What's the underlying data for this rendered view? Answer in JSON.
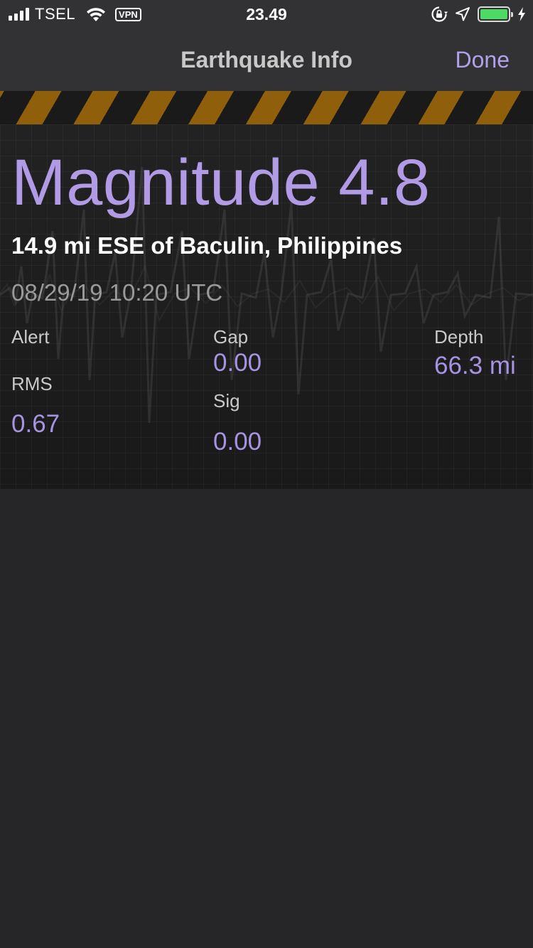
{
  "status_bar": {
    "carrier": "TSEL",
    "vpn_label": "VPN",
    "time": "23.49",
    "battery_level": 1.0,
    "icons": [
      "signal-icon",
      "wifi-icon",
      "vpn-badge",
      "rotation-lock-icon",
      "location-arrow-icon",
      "battery-icon",
      "charging-bolt-icon"
    ]
  },
  "nav": {
    "title": "Earthquake Info",
    "done_label": "Done"
  },
  "quake": {
    "magnitude_text": "Magnitude 4.8",
    "location": "14.9 mi ESE of Baculin, Philippines",
    "datetime": "08/29/19 10:20 UTC",
    "alert_label": "Alert",
    "gap_label": "Gap",
    "gap_value": "0.00",
    "depth_label": "Depth",
    "depth_value": "66.3 mi",
    "rms_label": "RMS",
    "rms_value": "0.67",
    "sig_label": "Sig",
    "sig_value": "0.00"
  },
  "colors": {
    "accent": "#b19be6",
    "hazard_stripe": "#8f5f0c",
    "background": "#262628",
    "bar_background": "#323234",
    "battery_green": "#4cd964"
  }
}
